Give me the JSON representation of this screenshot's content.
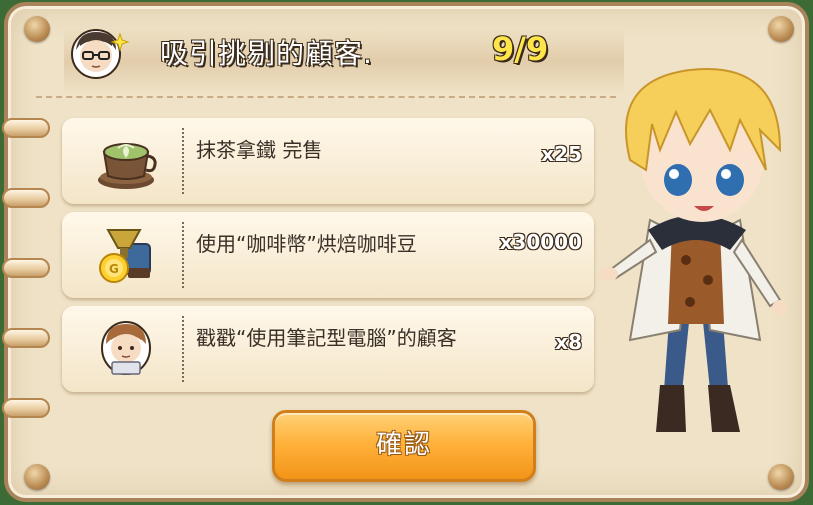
{
  "quest": {
    "title": "吸引挑剔的顧客.",
    "progress": "9/9"
  },
  "tasks": [
    {
      "label": "抹茶拿鐵 完售",
      "qty": "x25",
      "icon": "matcha-latte-icon"
    },
    {
      "label": "使用“咖啡幣”烘焙咖啡豆",
      "qty": "x30000",
      "icon": "coffee-roaster-coin-icon"
    },
    {
      "label": "戳戳“使用筆記型電腦”的顧客",
      "qty": "x8",
      "icon": "laptop-customer-icon"
    }
  ],
  "confirm_label": "確認",
  "colors": {
    "panel": "#efe2c6",
    "accent_yellow": "#ffe44a",
    "button_orange": "#ffb23c"
  }
}
